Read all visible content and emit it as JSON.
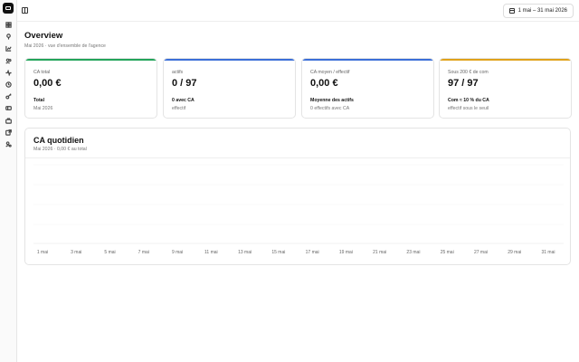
{
  "topbar": {
    "date_range": "1 mai – 31 mai 2026"
  },
  "sidebar": {
    "icons": [
      "grid-icon",
      "pin-icon",
      "chart-icon",
      "users-icon",
      "activity-icon",
      "clock-icon",
      "key-icon",
      "ticket-icon",
      "briefcase-icon",
      "external-icon",
      "user-cog-icon"
    ]
  },
  "page": {
    "title": "Overview",
    "subtitle": "Mai 2026 · vue d'ensemble de l'agence"
  },
  "cards": [
    {
      "label": "CA total",
      "value": "0,00 €",
      "strong": "Total",
      "note": "Mai 2026",
      "color": "#22a45a"
    },
    {
      "label": "actifs",
      "value": "0 / 97",
      "strong": "0 avec CA",
      "note": "effectif",
      "color": "#3b6fd8"
    },
    {
      "label": "CA moyen / effectif",
      "value": "0,00 €",
      "strong": "Moyenne des actifs",
      "note": "0 effectifs avec CA",
      "color": "#3b6fd8"
    },
    {
      "label": "Sous 200 € de com",
      "value": "97 / 97",
      "strong": "Com ≈ 10 % du CA",
      "note": "effectif sous le seuil",
      "color": "#e0a21a"
    }
  ],
  "chart": {
    "title": "CA quotidien",
    "subtitle": "Mai 2026 · 0,00 € au total"
  },
  "chart_data": {
    "type": "bar",
    "categories": [
      "1 mai",
      "3 mai",
      "5 mai",
      "7 mai",
      "9 mai",
      "11 mai",
      "13 mai",
      "15 mai",
      "17 mai",
      "19 mai",
      "21 mai",
      "23 mai",
      "25 mai",
      "27 mai",
      "29 mai",
      "31 mai"
    ],
    "values": [
      0,
      0,
      0,
      0,
      0,
      0,
      0,
      0,
      0,
      0,
      0,
      0,
      0,
      0,
      0,
      0
    ],
    "title": "CA quotidien",
    "grid": true
  }
}
